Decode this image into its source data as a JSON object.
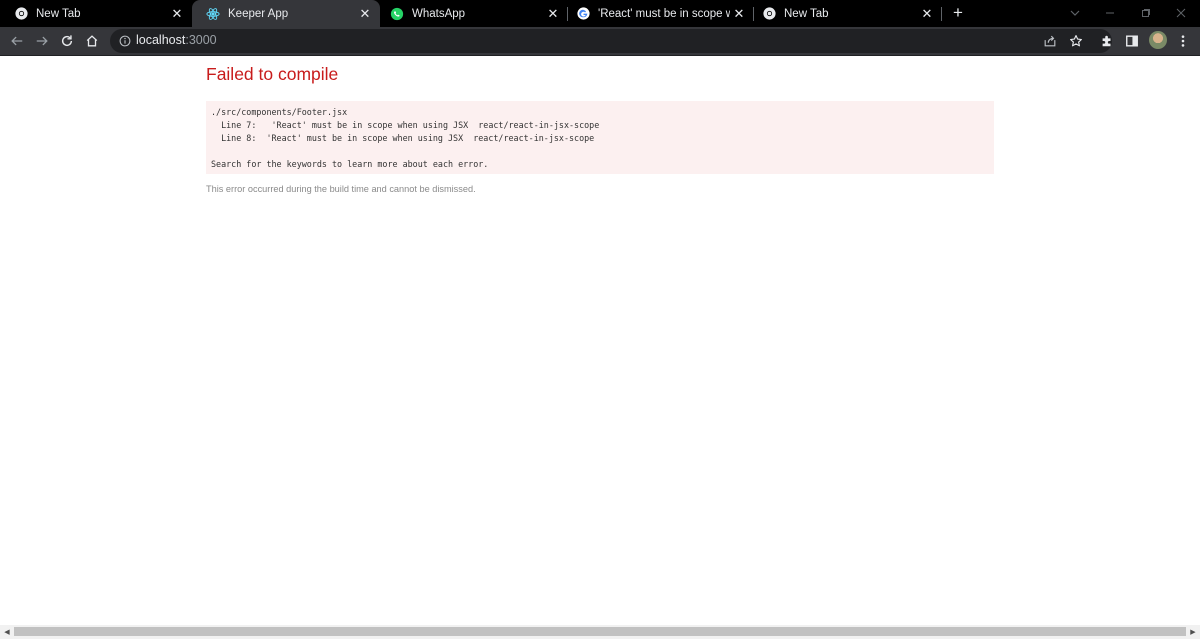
{
  "browser": {
    "tabs": [
      {
        "label": "New Tab",
        "icon": "chrome-icon"
      },
      {
        "label": "Keeper App",
        "icon": "react-icon",
        "active": true
      },
      {
        "label": "WhatsApp",
        "icon": "whatsapp-icon"
      },
      {
        "label": "'React' must be in scope when us",
        "icon": "google-icon"
      },
      {
        "label": "New Tab",
        "icon": "chrome-icon"
      }
    ],
    "close_glyph": "✕",
    "new_tab_glyph": "+",
    "url_host": "localhost",
    "url_port": ":3000"
  },
  "page": {
    "title": "Failed to compile",
    "error_lines": [
      "./src/components/Footer.jsx",
      "  Line 7:   'React' must be in scope when using JSX  react/react-in-jsx-scope",
      "  Line 8:  'React' must be in scope when using JSX  react/react-in-jsx-scope",
      "",
      "Search for the keywords to learn more about each error."
    ],
    "footnote": "This error occurred during the build time and cannot be dismissed."
  },
  "colors": {
    "tabstrip_bg": "#000000",
    "toolbar_bg": "#35363a",
    "error_title": "#c81c1c",
    "error_box_bg": "#fcf0f0"
  }
}
